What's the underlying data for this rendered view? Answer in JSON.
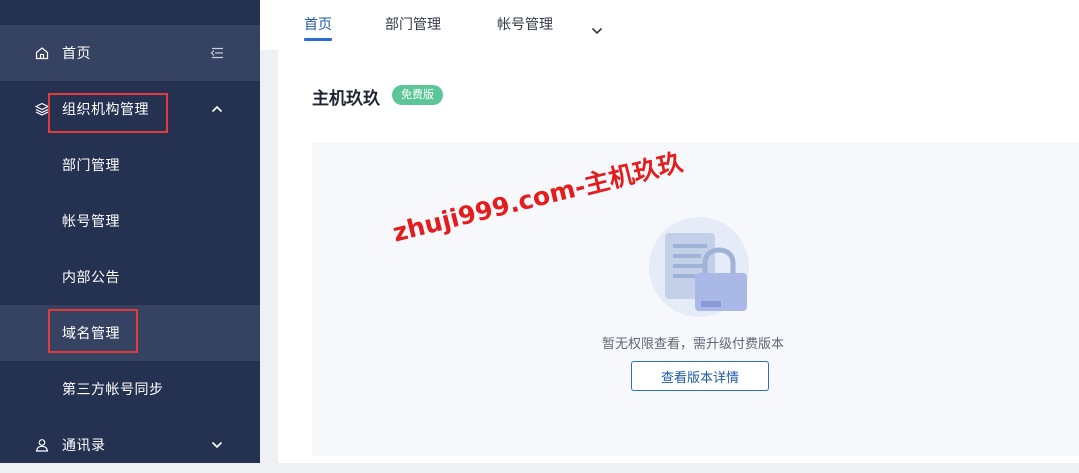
{
  "sidebar": {
    "items": [
      {
        "label": "首页",
        "icon": "home-icon",
        "right_icon": "collapse-menu-icon",
        "active": true
      },
      {
        "label": "组织机构管理",
        "icon": "layers-icon",
        "right_icon": "chevron-up-icon",
        "highlighted": true
      },
      {
        "label": "部门管理"
      },
      {
        "label": "帐号管理"
      },
      {
        "label": "内部公告"
      },
      {
        "label": "域名管理",
        "active": true,
        "highlighted": true
      },
      {
        "label": "第三方帐号同步"
      },
      {
        "label": "通讯录",
        "icon": "user-icon",
        "right_icon": "chevron-down-icon"
      }
    ]
  },
  "tabs": [
    {
      "label": "首页",
      "active": true
    },
    {
      "label": "部门管理"
    },
    {
      "label": "帐号管理"
    }
  ],
  "tabs_more_icon": "chevron-down-icon",
  "main": {
    "title": "主机玖玖",
    "badge": "免费版",
    "empty_message": "暂无权限查看，需升级付费版本",
    "detail_button": "查看版本详情",
    "watermark": "zhuji999.com-主机玖玖"
  },
  "colors": {
    "sidebar_bg": "#253150",
    "sidebar_active": "#354262",
    "accent": "#2a6dd3",
    "badge": "#5cc698",
    "highlight_box": "#e33a3a",
    "watermark": "#e51c1c"
  }
}
